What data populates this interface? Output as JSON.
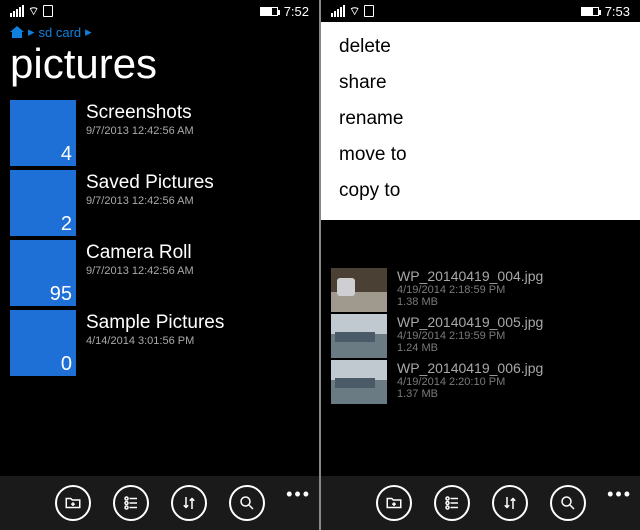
{
  "left": {
    "status": {
      "time": "7:52"
    },
    "breadcrumb": {
      "label": "sd card",
      "separator": "▸"
    },
    "title": "pictures",
    "folders": [
      {
        "name": "Screenshots",
        "date": "9/7/2013 12:42:56 AM",
        "count": "4"
      },
      {
        "name": "Saved Pictures",
        "date": "9/7/2013 12:42:56 AM",
        "count": "2"
      },
      {
        "name": "Camera Roll",
        "date": "9/7/2013 12:42:56 AM",
        "count": "95"
      },
      {
        "name": "Sample Pictures",
        "date": "4/14/2014 3:01:56 PM",
        "count": "0"
      }
    ]
  },
  "right": {
    "status": {
      "time": "7:53"
    },
    "context_menu": [
      {
        "label": "delete"
      },
      {
        "label": "share"
      },
      {
        "label": "rename"
      },
      {
        "label": "move to"
      },
      {
        "label": "copy to"
      }
    ],
    "files": [
      {
        "name": "WP_20140419_004.jpg",
        "date": "4/19/2014 2:18:59 PM",
        "size": "1.38 MB"
      },
      {
        "name": "WP_20140419_005.jpg",
        "date": "4/19/2014 2:19:59 PM",
        "size": "1.24 MB"
      },
      {
        "name": "WP_20140419_006.jpg",
        "date": "4/19/2014 2:20:10 PM",
        "size": "1.37 MB"
      }
    ]
  },
  "appbar": {
    "new_folder": "new folder",
    "select": "select",
    "sort": "sort",
    "search": "search",
    "more": "more"
  }
}
